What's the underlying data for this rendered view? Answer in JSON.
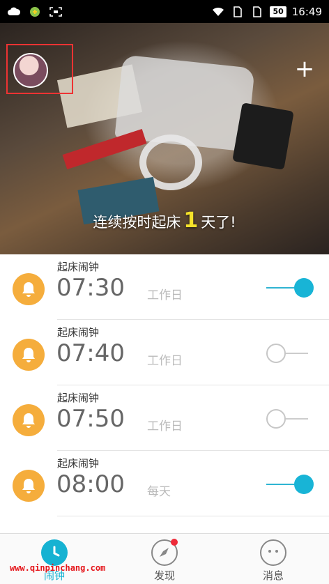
{
  "status_bar": {
    "battery": "50",
    "time": "16:49"
  },
  "hero": {
    "streak_prefix": "连续按时起床",
    "streak_count": "1",
    "streak_suffix": "天了!",
    "add_label": "+"
  },
  "alarms": [
    {
      "label": "起床闹钟",
      "time": "07:30",
      "repeat": "工作日",
      "enabled": true
    },
    {
      "label": "起床闹钟",
      "time": "07:40",
      "repeat": "工作日",
      "enabled": false
    },
    {
      "label": "起床闹钟",
      "time": "07:50",
      "repeat": "工作日",
      "enabled": false
    },
    {
      "label": "起床闹钟",
      "time": "08:00",
      "repeat": "每天",
      "enabled": true
    }
  ],
  "bottom_nav": {
    "alarm": "闹钟",
    "discover": "发现",
    "messages": "消息"
  },
  "watermark": "www.qinpinchang.com",
  "colors": {
    "accent": "#16b2d2",
    "bell": "#f5ad3c",
    "badge": "#ee2b3a"
  }
}
